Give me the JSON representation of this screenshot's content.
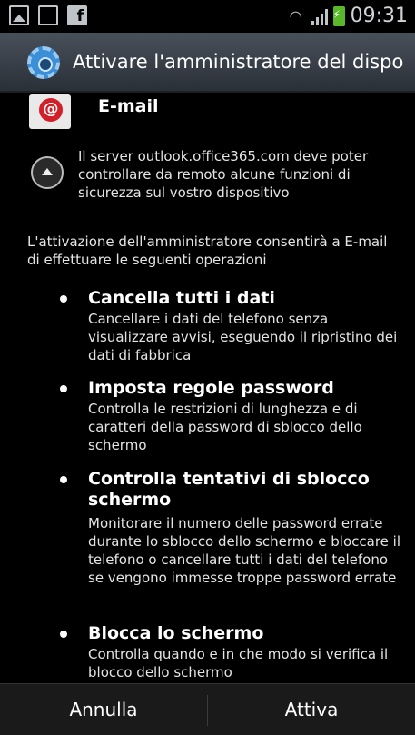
{
  "status_bar": {
    "icons": [
      "gallery-icon",
      "usb-debug-icon",
      "facebook-icon",
      "wifi-icon",
      "signal-icon",
      "battery-charging-icon"
    ],
    "time": "09:31",
    "battery_color": "#58b82a"
  },
  "title_bar": {
    "title": "Attivare l'amministratore del dispo",
    "icon": "settings-gear-icon"
  },
  "app": {
    "name": "E-mail",
    "icon_glyph": "@",
    "icon_color": "#d2202a"
  },
  "server_message": "Il server outlook.office365.com deve poter controllare da remoto alcune funzioni di sicurezza sul vostro dispositivo",
  "intro": "L'attivazione dell'amministratore consentirà a E-mail di effettuare le seguenti operazioni",
  "permissions": [
    {
      "title": "Cancella tutti i dati",
      "description": "Cancellare i dati del telefono senza visualizzare avvisi, eseguendo il ripristino dei dati di fabbrica"
    },
    {
      "title": "Imposta regole password",
      "description": "Controlla le restrizioni di lunghezza e di caratteri della password di sblocco dello schermo"
    },
    {
      "title": "Controlla tentativi di sblocco schermo",
      "description": "Monitorare il numero delle password errate durante lo sblocco dello schermo e bloccare il telefono o cancellare tutti i dati del telefono se vengono immesse troppe password errate"
    },
    {
      "title": "Blocca lo schermo",
      "description": "Controlla quando e in che modo si verifica il blocco dello schermo"
    }
  ],
  "buttons": {
    "cancel": "Annulla",
    "activate": "Attiva"
  }
}
